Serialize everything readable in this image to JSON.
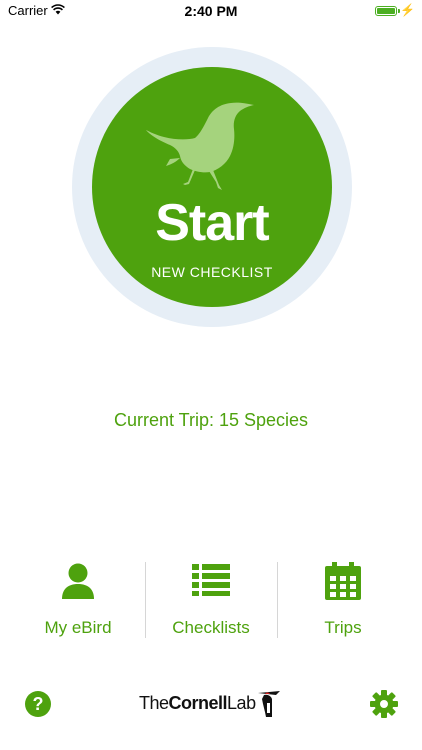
{
  "status_bar": {
    "carrier": "Carrier",
    "time": "2:40 PM"
  },
  "start_button": {
    "title": "Start",
    "subtitle": "NEW CHECKLIST"
  },
  "current_trip": "Current Trip: 15 Species",
  "tabs": [
    {
      "label": "My eBird",
      "icon": "person-icon"
    },
    {
      "label": "Checklists",
      "icon": "list-icon"
    },
    {
      "label": "Trips",
      "icon": "calendar-icon"
    }
  ],
  "footer": {
    "logo_the": "The",
    "logo_cornell": "Cornell",
    "logo_lab": "Lab"
  },
  "colors": {
    "accent": "#4ea20e",
    "ring": "#e6eef6",
    "bird": "#a5d37d"
  }
}
